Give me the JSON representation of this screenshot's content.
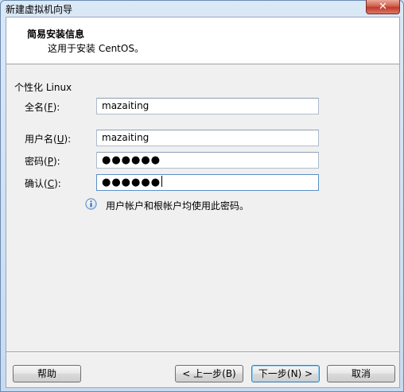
{
  "window": {
    "title": "新建虚拟机向导",
    "close_label": "✕"
  },
  "header": {
    "title": "简易安装信息",
    "subtitle": "这用于安装 CentOS。"
  },
  "section": {
    "label": "个性化 Linux"
  },
  "fields": {
    "full_name": {
      "label_pre": "全名(",
      "accel": "F",
      "label_post": "):",
      "value": "mazaiting"
    },
    "username": {
      "label_pre": "用户名(",
      "accel": "U",
      "label_post": "):",
      "value": "mazaiting"
    },
    "password": {
      "label_pre": "密码(",
      "accel": "P",
      "label_post": "):",
      "value": "●●●●●●"
    },
    "confirm": {
      "label_pre": "确认(",
      "accel": "C",
      "label_post": "):",
      "value": "●●●●●●"
    }
  },
  "info": {
    "icon": "info-icon",
    "text": "用户帐户和根帐户均使用此密码。"
  },
  "buttons": {
    "help": "帮助",
    "back": "< 上一步(B)",
    "next": "下一步(N) >",
    "cancel": "取消"
  },
  "colors": {
    "title_gradient_top": "#dbe8f6",
    "close_red": "#c0392b",
    "default_button_border": "#3c7fb1"
  }
}
